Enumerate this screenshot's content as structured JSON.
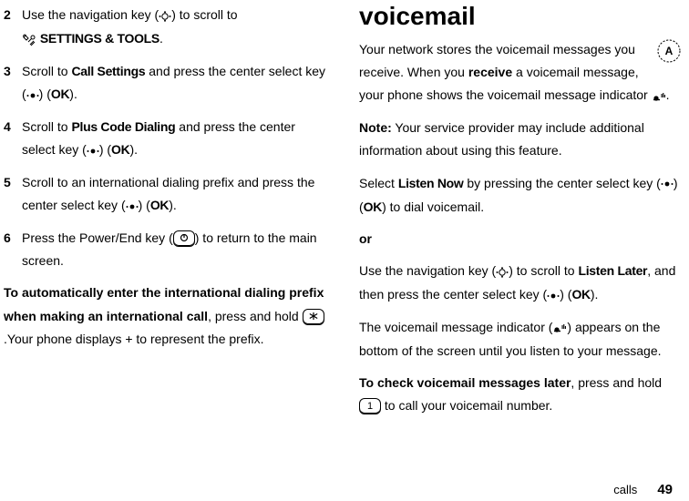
{
  "left": {
    "steps": [
      {
        "num": "2",
        "pre": "Use the navigation key (",
        "mid": ") to scroll to ",
        "tools_label": "SETTINGS & TOOLS",
        "post": "."
      },
      {
        "num": "3",
        "pre": "Scroll to ",
        "target": "Call Settings",
        "mid": " and press the center select key (",
        "ok": "OK",
        "post": ")."
      },
      {
        "num": "4",
        "pre": "Scroll to ",
        "target": "Plus Code Dialing",
        "mid": " and press the center select key (",
        "ok": "OK",
        "post": ")."
      },
      {
        "num": "5",
        "pre": "Scroll to an international dialing prefix and press the center select key (",
        "ok": "OK",
        "post": ")."
      },
      {
        "num": "6",
        "pre": "Press the Power/End key (",
        "post": ") to return to the main screen."
      }
    ],
    "para": {
      "lead_bold": "To automatically enter the international dialing prefix when making an international call",
      "after_lead": ", press and hold ",
      "key_label": "*",
      "tail": ".Your phone displays + to represent the prefix."
    }
  },
  "right": {
    "title": "voicemail",
    "p1": {
      "a": "Your network stores the voicemail messages you receive. When you ",
      "b": "receive",
      "c": " a voicemail message, your phone shows the voicemail message indicator ",
      "d": "."
    },
    "note": {
      "label": "Note:",
      "text": " Your service provider may include additional information about using this feature."
    },
    "p2": {
      "a": "Select ",
      "listen_now": "Listen Now",
      "b": " by pressing the center select key (",
      "ok": "OK",
      "c": ") to dial voicemail."
    },
    "or": "or",
    "p3": {
      "a": "Use the navigation key (",
      "b": ") to scroll to ",
      "listen_later": "Listen Later",
      "c": ", and then press the center select key (",
      "ok": "OK",
      "d": ")."
    },
    "p4": {
      "a": "The voicemail message indicator (",
      "b": ") appears on the bottom of the screen until you listen to your message."
    },
    "p5": {
      "lead_bold": "To check voicemail messages later",
      "a": ", press and hold ",
      "key_label": "1",
      "b": " to call your voicemail number."
    }
  },
  "footer": {
    "label": "calls",
    "page": "49"
  }
}
